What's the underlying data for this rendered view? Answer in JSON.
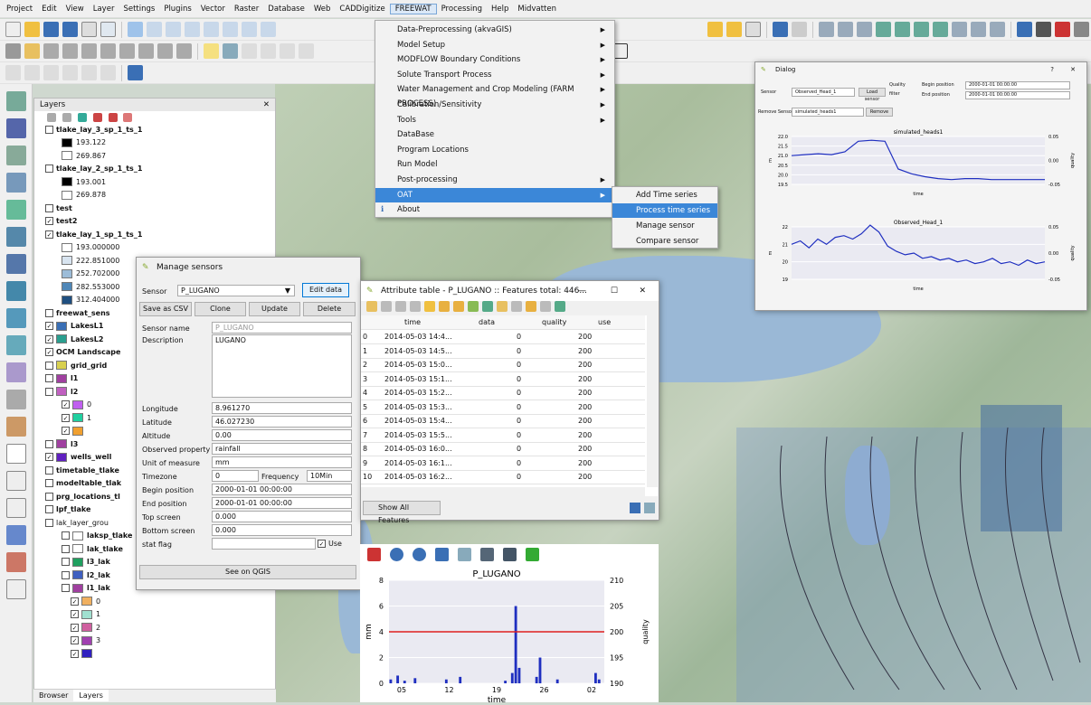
{
  "menubar": {
    "items": [
      "Project",
      "Edit",
      "View",
      "Layer",
      "Settings",
      "Plugins",
      "Vector",
      "Raster",
      "Database",
      "Web",
      "CADDigitize",
      "FREEWAT",
      "Processing",
      "Help",
      "Midvatten"
    ]
  },
  "freewat_menu": {
    "items": [
      "Data-Preprocessing (akvaGIS)",
      "Model Setup",
      "MODFLOW Boundary Conditions",
      "Solute Transport Process",
      "Water Management and Crop Modeling (FARM PROCESS)",
      "Calibration/Sensitivity",
      "Tools",
      "DataBase",
      "Program Locations",
      "Run Model",
      "Post-processing",
      "OAT",
      "About"
    ]
  },
  "oat_submenu": {
    "items": [
      "Add Time series",
      "Process time series",
      "Manage sensor",
      "Compare sensor"
    ]
  },
  "layers": {
    "title": "Layers",
    "bottom_tabs": [
      "Browser",
      "Layers"
    ],
    "rows": [
      {
        "label": "tlake_lay_3_sp_1_ts_1",
        "bold": true
      },
      {
        "label": "193.122"
      },
      {
        "label": "269.867"
      },
      {
        "label": "tlake_lay_2_sp_1_ts_1",
        "bold": true
      },
      {
        "label": "193.001"
      },
      {
        "label": "269.878"
      },
      {
        "label": "test",
        "bold": true
      },
      {
        "label": "test2",
        "bold": true
      },
      {
        "label": "tlake_lay_1_sp_1_ts_1",
        "bold": true
      },
      {
        "label": "193.000000"
      },
      {
        "label": "222.851000"
      },
      {
        "label": "252.702000"
      },
      {
        "label": "282.553000"
      },
      {
        "label": "312.404000"
      },
      {
        "label": "freewat_sens",
        "bold": true
      },
      {
        "label": "LakesL1",
        "bold": true
      },
      {
        "label": "LakesL2",
        "bold": true
      },
      {
        "label": "OCM Landscape",
        "bold": true
      },
      {
        "label": "grid_grid",
        "bold": true
      },
      {
        "label": "l1",
        "bold": true
      },
      {
        "label": "l2",
        "bold": true
      },
      {
        "label": "0"
      },
      {
        "label": "1"
      },
      {
        "label": ""
      },
      {
        "label": "l3",
        "bold": true
      },
      {
        "label": "wells_well",
        "bold": true
      },
      {
        "label": "timetable_tlake",
        "bold": true
      },
      {
        "label": "modeltable_tlak",
        "bold": true
      },
      {
        "label": "prg_locations_tl",
        "bold": true
      },
      {
        "label": "lpf_tlake",
        "bold": true
      },
      {
        "label": "lak_layer_grou",
        "bold": false
      },
      {
        "label": "laksp_tlake",
        "bold": true
      },
      {
        "label": "lak_tlake",
        "bold": true
      },
      {
        "label": "l3_lak",
        "bold": true
      },
      {
        "label": "l2_lak",
        "bold": true
      },
      {
        "label": "l1_lak",
        "bold": true
      },
      {
        "label": "0"
      },
      {
        "label": "1"
      },
      {
        "label": "2"
      },
      {
        "label": "3"
      },
      {
        "label": ""
      }
    ]
  },
  "manage_sensors": {
    "title": "Manage sensors",
    "sensor_label": "Sensor",
    "sensor_value": "P_LUGANO",
    "edit_data": "Edit data",
    "save_csv": "Save as CSV",
    "clone": "Clone",
    "update": "Update",
    "delete": "Delete",
    "sensor_name_label": "Sensor name",
    "sensor_name_placeholder": "P_LUGANO",
    "description_label": "Description",
    "description_value": "LUGANO",
    "longitude_label": "Longitude",
    "longitude_value": "8.961270",
    "latitude_label": "Latitude",
    "latitude_value": "46.027230",
    "altitude_label": "Altitude",
    "altitude_value": "0.00",
    "obs_label": "Observed property",
    "obs_value": "rainfall",
    "unit_label": "Unit of measure",
    "unit_value": "mm",
    "tz_label": "Timezone",
    "tz_value": "0",
    "freq_label": "Frequency",
    "freq_value": "10Min",
    "begin_label": "Begin position",
    "begin_value": "2000-01-01 00:00:00",
    "end_label": "End position",
    "end_value": "2000-01-01 00:00:00",
    "top_label": "Top screen",
    "top_value": "0.000",
    "bottom_label": "Bottom screen",
    "bottom_value": "0.000",
    "stat_label": "stat flag",
    "use_label": "Use",
    "see_qgis": "See on QGIS"
  },
  "attr_table": {
    "title": "Attribute table - P_LUGANO :: Features total: 446...",
    "columns": [
      "time",
      "data",
      "quality",
      "use"
    ],
    "rows": [
      [
        "0",
        "2014-05-03 14:4...",
        "0",
        "200"
      ],
      [
        "1",
        "2014-05-03 14:5...",
        "0",
        "200"
      ],
      [
        "2",
        "2014-05-03 15:0...",
        "0",
        "200"
      ],
      [
        "3",
        "2014-05-03 15:1...",
        "0",
        "200"
      ],
      [
        "4",
        "2014-05-03 15:2...",
        "0",
        "200"
      ],
      [
        "5",
        "2014-05-03 15:3...",
        "0",
        "200"
      ],
      [
        "6",
        "2014-05-03 15:4...",
        "0",
        "200"
      ],
      [
        "7",
        "2014-05-03 15:5...",
        "0",
        "200"
      ],
      [
        "8",
        "2014-05-03 16:0...",
        "0",
        "200"
      ],
      [
        "9",
        "2014-05-03 16:1...",
        "0",
        "200"
      ],
      [
        "10",
        "2014-05-03 16:2...",
        "0",
        "200"
      ]
    ],
    "show_all": "Show All Features"
  },
  "plot": {
    "title": "P_LUGANO",
    "ylabel": "mm",
    "y2label": "quality",
    "xlabel": "time",
    "y_ticks": [
      "0",
      "2",
      "4",
      "6",
      "8"
    ],
    "y2_ticks": [
      "190",
      "195",
      "200",
      "205",
      "210"
    ],
    "x_ticks": [
      "05",
      "12",
      "19",
      "26",
      "02"
    ]
  },
  "dialog": {
    "title": "Dialog",
    "sensor_label": "Sensor",
    "sensor_value": "Observed_Head_1",
    "load_sensor": "Load sensor",
    "quality_label": "Quality",
    "filter_label": "filter",
    "begin_label": "Begin position",
    "begin_value": "2000-01-01 00:00:00",
    "end_label": "End position",
    "end_value": "2000-01-01 00:00:00",
    "remove_label": "Remove Sensor",
    "remove_value": "simulated_heads1",
    "remove_btn": "Remove",
    "chart1": {
      "title": "simulated_heads1",
      "ylabel": "m",
      "y2label": "quality",
      "xlabel": "time",
      "y_ticks": [
        "19.5",
        "20.0",
        "20.5",
        "21.0",
        "21.5",
        "22.0"
      ],
      "y2_ticks": [
        "-0.05",
        "0.00",
        "0.05"
      ]
    },
    "chart2": {
      "title": "Observed_Head_1",
      "ylabel": "m",
      "y2label": "quality",
      "xlabel": "time",
      "y_ticks": [
        "19",
        "20",
        "21",
        "22"
      ],
      "y2_ticks": [
        "-0.05",
        "0.00",
        "0.05"
      ]
    }
  },
  "chart_data": [
    {
      "type": "bar",
      "title": "P_LUGANO",
      "xlabel": "time",
      "ylabel": "mm",
      "ylim": [
        0,
        8
      ],
      "x_ticks": [
        "05",
        "12",
        "19",
        "26",
        "02"
      ],
      "series": [
        {
          "name": "data",
          "values": [
            0.3,
            0,
            0.6,
            0,
            0.2,
            0,
            0,
            0.4,
            0,
            0,
            0,
            0,
            0,
            0,
            0,
            0,
            0.3,
            0,
            0,
            0,
            0.5,
            0,
            0,
            0,
            0,
            0,
            0,
            0,
            0,
            0,
            0,
            0,
            0,
            0.2,
            0,
            0.8,
            6.0,
            1.2,
            0,
            0,
            0,
            0,
            0.5,
            2.0,
            0,
            0,
            0,
            0,
            0.3,
            0,
            0,
            0,
            0,
            0,
            0,
            0,
            0,
            0,
            0,
            0.8,
            0.3,
            0
          ]
        },
        {
          "name": "quality",
          "values": [
            200
          ]
        }
      ],
      "y2lim": [
        190,
        210
      ]
    },
    {
      "type": "line",
      "title": "simulated_heads1",
      "xlabel": "time",
      "ylabel": "m",
      "ylim": [
        19.5,
        22.0
      ],
      "series": [
        {
          "values": [
            21.0,
            21.05,
            21.1,
            21.05,
            21.2,
            21.75,
            21.8,
            21.75,
            20.3,
            20.05,
            19.9,
            19.8,
            19.75,
            19.8,
            19.8,
            19.75,
            19.75,
            19.75,
            19.75,
            19.75
          ]
        }
      ]
    },
    {
      "type": "line",
      "title": "Observed_Head_1",
      "xlabel": "time",
      "ylabel": "m",
      "ylim": [
        19,
        22
      ],
      "series": [
        {
          "values": [
            21.0,
            21.2,
            20.8,
            21.3,
            21.0,
            21.4,
            21.5,
            21.3,
            21.6,
            22.1,
            21.7,
            20.9,
            20.6,
            20.4,
            20.5,
            20.2,
            20.3,
            20.1,
            20.2,
            20.0,
            20.1,
            19.9,
            20.0,
            20.2,
            19.9,
            20.0,
            19.8,
            20.1,
            19.9,
            20.0
          ]
        }
      ]
    }
  ]
}
